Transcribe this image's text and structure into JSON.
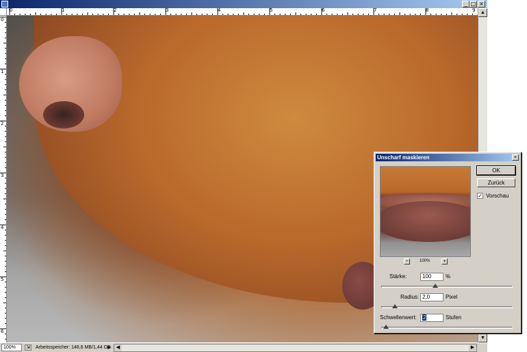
{
  "window": {
    "minimize_glyph": "_",
    "maximize_glyph": "□",
    "close_glyph": "×"
  },
  "rulers": {
    "horizontal": [
      "0",
      "1",
      "2",
      "3",
      "4",
      "5",
      "6",
      "7",
      "8",
      "9"
    ],
    "vertical": [
      "0",
      "1",
      "2",
      "3",
      "4",
      "5",
      "6"
    ]
  },
  "status": {
    "zoom": "100%",
    "memory": "Arbeitsspeicher: 148,6 MB/1,44 GB",
    "menu_arrow": "▶",
    "scroll_left": "◀",
    "scroll_right": "▶"
  },
  "scrollbar": {
    "up": "▲",
    "down": "▼"
  },
  "dialog": {
    "title": "Unscharf maskieren",
    "close_glyph": "×",
    "ok_label": "OK",
    "reset_label": "Zurück",
    "preview_checkbox_label": "Vorschau",
    "preview_checked": "✓",
    "preview_zoom": "100%",
    "zoom_out": "−",
    "zoom_in": "+",
    "amount_label": "Stärke:",
    "amount_value": "100",
    "amount_unit": "%",
    "amount_level": 0.4,
    "radius_label": "Radius:",
    "radius_value": "2,0",
    "radius_unit": "Pixel",
    "radius_level": 0.08,
    "threshold_label": "Schwellenwert:",
    "threshold_value": "2",
    "threshold_unit": "Stufen",
    "threshold_level": 0.01
  }
}
